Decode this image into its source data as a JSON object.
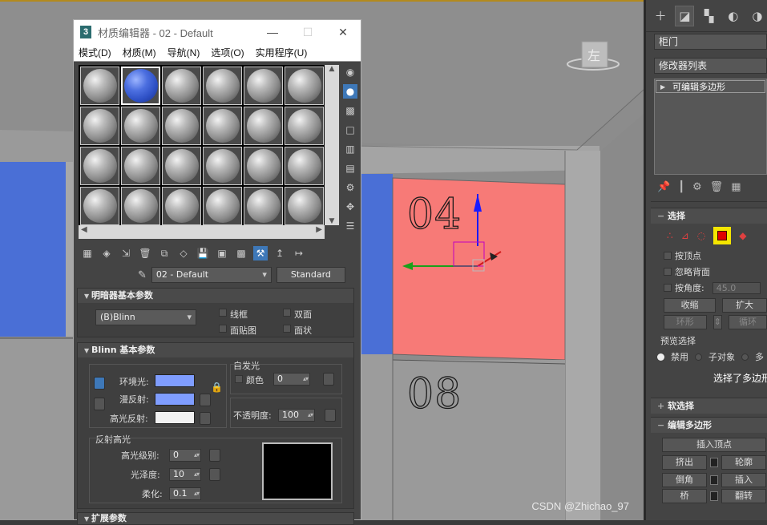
{
  "viewport": {
    "label_04": "04",
    "label_08": "08",
    "viewcube_label": "左",
    "watermark": "CSDN @Zhichao_97"
  },
  "material_editor": {
    "title": "材质编辑器 - 02 - Default",
    "logo": "3",
    "menus": [
      "模式(D)",
      "材质(M)",
      "导航(N)",
      "选项(O)",
      "实用程序(U)"
    ],
    "material_name": "02 - Default",
    "material_type": "Standard",
    "shader_rollout": {
      "title": "明暗器基本参数",
      "shader": "(B)Blinn",
      "options": [
        "线框",
        "双面",
        "面贴图",
        "面状"
      ]
    },
    "blinn_rollout": {
      "title": "Blinn 基本参数",
      "self_illum_label": "自发光",
      "color_label": "颜色",
      "self_illum_value": "0",
      "ambient_label": "环境光:",
      "diffuse_label": "漫反射:",
      "specular_label": "高光反射:",
      "opacity_label": "不透明度:",
      "opacity_value": "100",
      "ambient_color": "#7f9dff",
      "diffuse_color": "#7f9dff",
      "specular_color": "#f2f2f2",
      "highlights_label": "反射高光",
      "spec_level_label": "高光级别:",
      "spec_level_value": "0",
      "gloss_label": "光泽度:",
      "gloss_value": "10",
      "soften_label": "柔化:",
      "soften_value": "0.1"
    },
    "extended_rollout_title": "扩展参数"
  },
  "command_panel": {
    "object_name": "柜门",
    "modifier_list": "修改器列表",
    "stack_item": "可编辑多边形",
    "selection_rollout": "选择",
    "by_vertex": "按顶点",
    "ignore_backfacing": "忽略背面",
    "by_angle": "按角度:",
    "angle_value": "45.0",
    "shrink": "收缩",
    "grow": "扩大",
    "ring": "环形",
    "loop": "循环",
    "preview_selection": "预览选择",
    "preview_off": "禁用",
    "preview_subobj": "子对象",
    "preview_multi": "多",
    "selection_status": "选择了多边形",
    "soft_selection_rollout": "软选择",
    "edit_poly_rollout": "编辑多边形",
    "insert_vertex": "插入顶点",
    "extrude": "挤出",
    "outline": "轮廓",
    "bevel": "倒角",
    "inset": "插入",
    "bridge": "桥",
    "flip": "翻转"
  }
}
